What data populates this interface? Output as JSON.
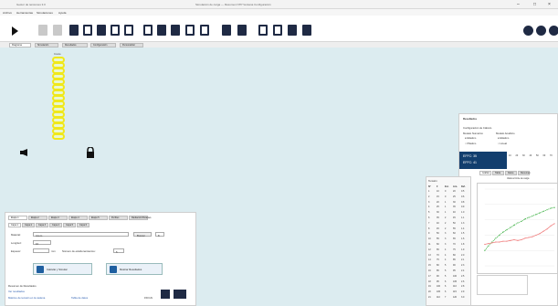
{
  "window": {
    "title": "Gestor de tensiones 3.0",
    "center_title": "Simulación de carga  —  Resumen NTP  Ventana  Configuración"
  },
  "menu": [
    "Archivo",
    "Herramientas",
    "Simulaciones",
    "Ayuda"
  ],
  "tabs": [
    "Diagrama",
    "Simulación",
    "Resultados",
    "Configuración",
    "Personalizar"
  ],
  "chain": {
    "top_label": "Cresta",
    "links": 15
  },
  "bottom_panel": {
    "tabs_row1": [
      "Etapa 1",
      "Etapa 2",
      "Etapa 3",
      "Etapa 4",
      "Etapa 5",
      "Perfiles",
      "Radiación/Paramet."
    ],
    "tabs_row2": [
      "Capa 1",
      "Capa 2",
      "Capa 3",
      "Capa 4",
      "Capa 5",
      "Capa 6"
    ],
    "material_label": "Material:",
    "material_value": "Acero",
    "buscar_label": "Buscar",
    "num_field": "8",
    "longitud_label": "Longitud:",
    "longitud_value": "10",
    "espesor_label": "Espesor:",
    "espesor_unit": "mm",
    "numero_label": "Número de eslabonamientos:",
    "numero_value": "5",
    "btn_calc": "Calcular y Simular",
    "btn_show": "Mostrar Resultados",
    "footer_title": "Resumen de Resultados",
    "footer_link1": "Ver resultados",
    "footer_link2": "Máximo de tensión en la cadena",
    "footer_link3": "Tabla de datos",
    "footer_value": "150 kN"
  },
  "results_panel": {
    "title": "Resultados",
    "config_label": "Configuración de Cálculo",
    "col1": "Modelo Numérico",
    "col2": "Modelo Analítico",
    "opt1": "Elástico",
    "opt2": "Elástico",
    "opt3": "Plástico",
    "opt4": "Lineal",
    "dark_line1": "EFFC: 35",
    "dark_line2": "EFFC: 41",
    "row_values": [
      "10",
      "20",
      "30",
      "40",
      "50",
      "60",
      "70"
    ],
    "subtabs": [
      "Gráfico",
      "Tabla",
      "Datos",
      "Resumen"
    ],
    "legend_note": "Valores límite de carga"
  },
  "table": {
    "title": "Tensión",
    "headers": [
      "Nº",
      "F",
      "Est.",
      "Lím.",
      "Def."
    ],
    "rows": [
      [
        "1",
        "10",
        "0",
        "20",
        "0.5"
      ],
      [
        "2",
        "15",
        "0",
        "25",
        "0.6"
      ],
      [
        "3",
        "20",
        "1",
        "30",
        "0.8"
      ],
      [
        "4",
        "25",
        "1",
        "35",
        "0.9"
      ],
      [
        "5",
        "30",
        "1",
        "40",
        "1.0"
      ],
      [
        "6",
        "35",
        "2",
        "45",
        "1.1"
      ],
      [
        "7",
        "40",
        "2",
        "50",
        "1.3"
      ],
      [
        "8",
        "45",
        "2",
        "55",
        "1.4"
      ],
      [
        "9",
        "50",
        "3",
        "60",
        "1.5"
      ],
      [
        "10",
        "55",
        "3",
        "65",
        "1.6"
      ],
      [
        "11",
        "60",
        "3",
        "70",
        "1.8"
      ],
      [
        "12",
        "65",
        "4",
        "75",
        "1.9"
      ],
      [
        "13",
        "70",
        "4",
        "80",
        "2.0"
      ],
      [
        "14",
        "75",
        "4",
        "85",
        "2.1"
      ],
      [
        "15",
        "80",
        "5",
        "90",
        "2.3"
      ],
      [
        "16",
        "85",
        "5",
        "95",
        "2.4"
      ],
      [
        "17",
        "90",
        "5",
        "100",
        "2.5"
      ],
      [
        "18",
        "95",
        "6",
        "105",
        "2.6"
      ],
      [
        "19",
        "100",
        "6",
        "110",
        "2.8"
      ],
      [
        "20",
        "105",
        "6",
        "115",
        "2.9"
      ],
      [
        "21",
        "110",
        "7",
        "120",
        "3.0"
      ]
    ]
  },
  "chart_data": {
    "type": "line",
    "x": [
      1,
      2,
      3,
      4,
      5,
      6,
      7,
      8,
      9,
      10,
      11,
      12,
      13,
      14,
      15,
      16,
      17,
      18,
      19,
      20
    ],
    "series": [
      {
        "name": "",
        "color": "#3cb043",
        "values": [
          20,
          26,
          31,
          36,
          40,
          44,
          47,
          50,
          53,
          56,
          58,
          61,
          63,
          65,
          67,
          69,
          71,
          73,
          75,
          76
        ]
      },
      {
        "name": "",
        "color": "#f08080",
        "values": [
          28,
          29,
          30,
          31,
          31,
          32,
          32,
          33,
          34,
          33,
          34,
          36,
          37,
          38,
          40,
          42,
          45,
          48,
          52,
          55
        ]
      }
    ],
    "ylim": [
      0,
      100
    ]
  },
  "colors": {
    "workspace": "#dcecf0",
    "chain": "#f0e81a",
    "dark": "#123e6e",
    "toolbar_icon": "#1f2a44"
  }
}
